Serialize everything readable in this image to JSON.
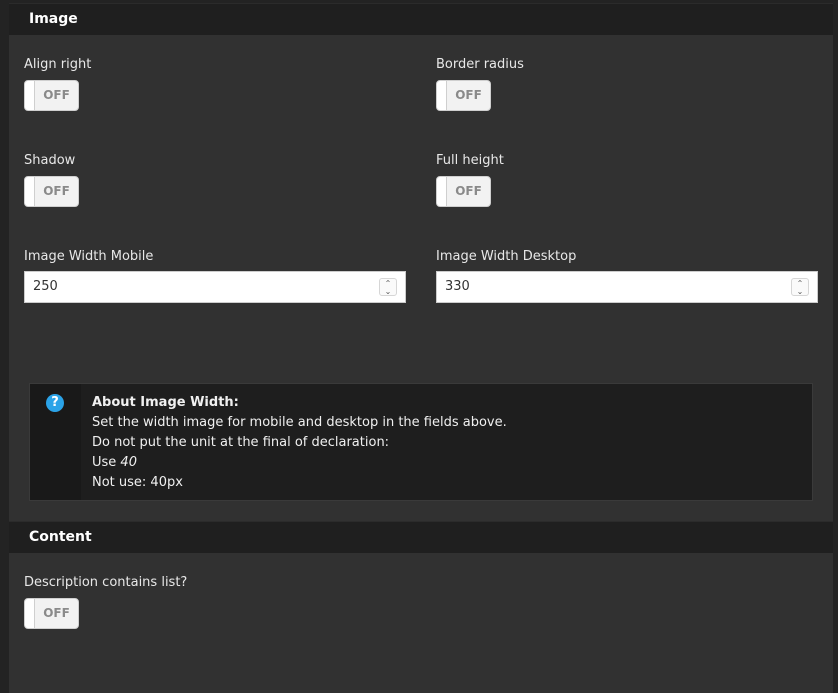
{
  "sections": {
    "image": {
      "title": "Image",
      "align_right": {
        "label": "Align right",
        "state": "OFF"
      },
      "border_radius": {
        "label": "Border radius",
        "state": "OFF"
      },
      "shadow": {
        "label": "Shadow",
        "state": "OFF"
      },
      "full_height": {
        "label": "Full height",
        "state": "OFF"
      },
      "width_mobile": {
        "label": "Image Width Mobile",
        "value": "250"
      },
      "width_desktop": {
        "label": "Image Width Desktop",
        "value": "330"
      },
      "info": {
        "icon": "question-circle-icon",
        "title": "About Image Width:",
        "line1": "Set the width image for mobile and desktop in the fields above.",
        "line2": "Do not put the unit at the final of declaration:",
        "line3_prefix": "Use ",
        "line3_value": "40",
        "line4": "Not use: 40px"
      }
    },
    "content": {
      "title": "Content",
      "description_list": {
        "label": "Description contains list?",
        "state": "OFF"
      }
    }
  },
  "colors": {
    "accent_info_icon": "#2ba3e8",
    "header_bg": "#1f1f1f",
    "panel_bg": "#313131"
  }
}
